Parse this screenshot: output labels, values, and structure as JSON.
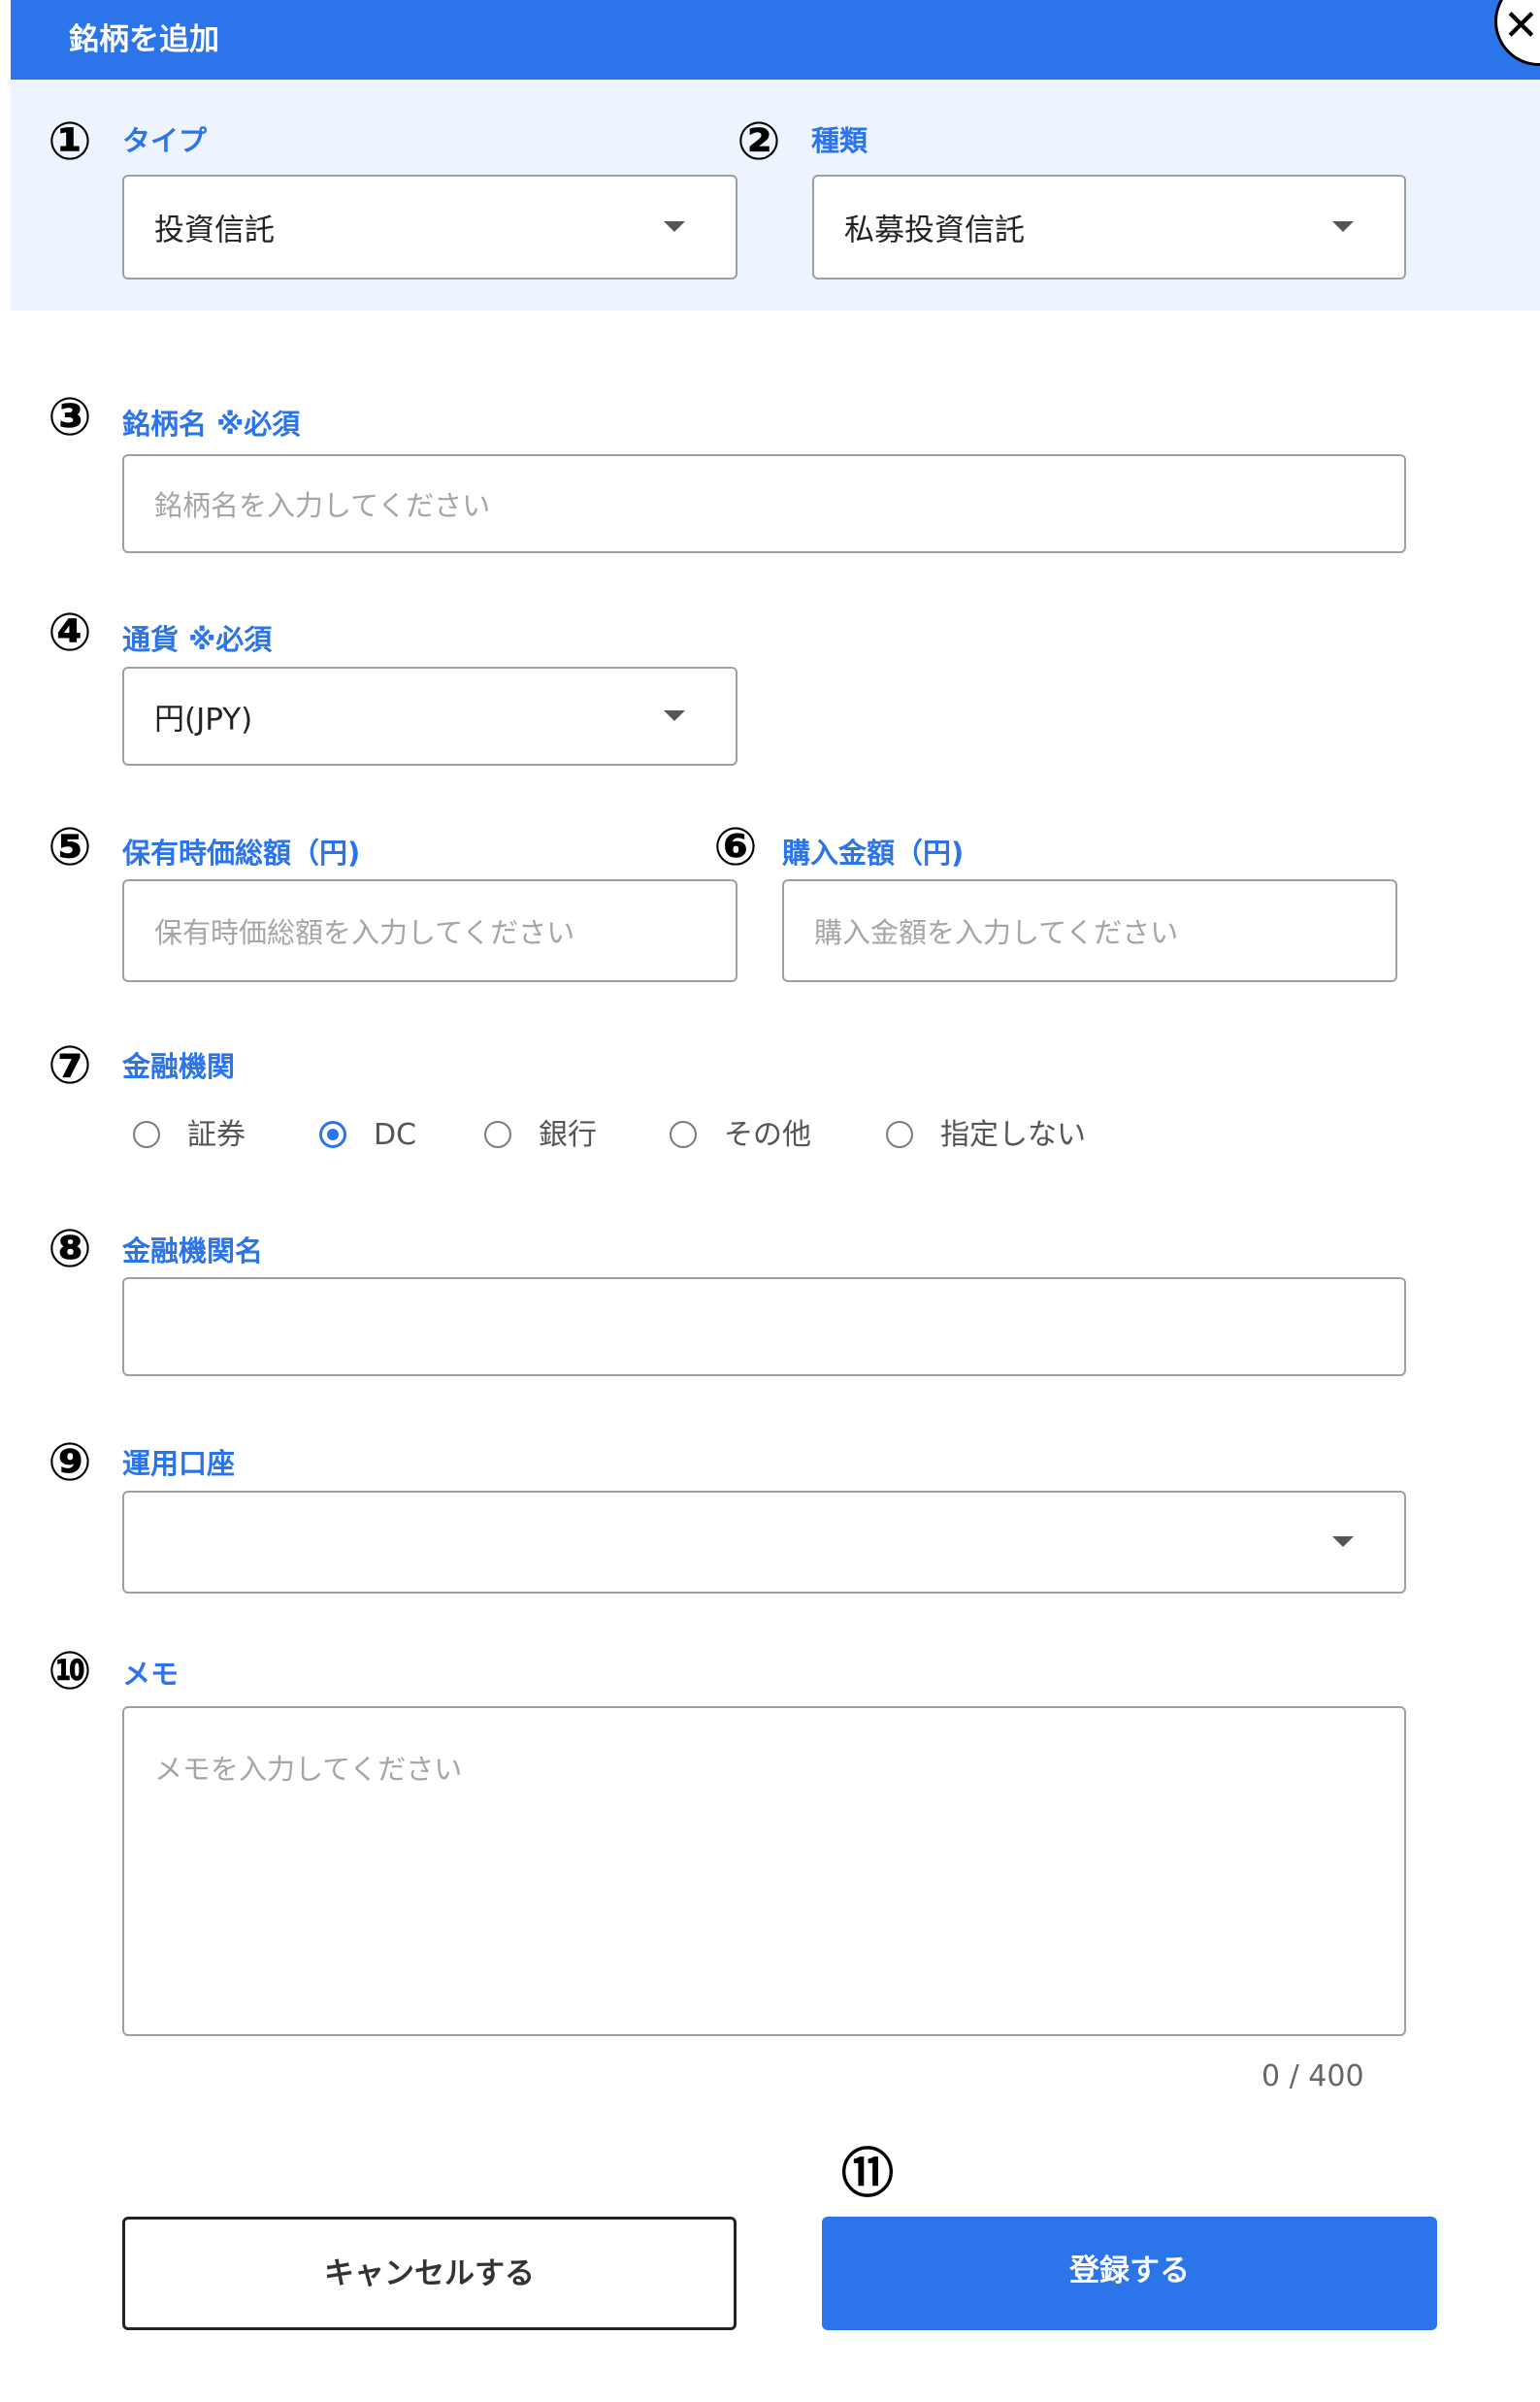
{
  "dialog": {
    "title": "銘柄を追加"
  },
  "fields": {
    "type": {
      "num": "①",
      "label": "タイプ",
      "value": "投資信託"
    },
    "kind": {
      "num": "②",
      "label": "種類",
      "value": "私募投資信託"
    },
    "name": {
      "num": "③",
      "label": "銘柄名 ※必須",
      "placeholder": "銘柄名を入力してください"
    },
    "currency": {
      "num": "④",
      "label": "通貨 ※必須",
      "value": "円(JPY)"
    },
    "holding_total": {
      "num": "⑤",
      "label": "保有時価総額（円)",
      "placeholder": "保有時価総額を入力してください"
    },
    "purchase_amount": {
      "num": "⑥",
      "label": "購入金額（円)",
      "placeholder": "購入金額を入力してください"
    },
    "institution": {
      "num": "⑦",
      "label": "金融機関",
      "options": [
        "証券",
        "DC",
        "銀行",
        "その他",
        "指定しない"
      ],
      "selected": "DC"
    },
    "institution_name": {
      "num": "⑧",
      "label": "金融機関名",
      "value": ""
    },
    "account": {
      "num": "⑨",
      "label": "運用口座",
      "value": ""
    },
    "memo": {
      "num": "⑩",
      "label": "メモ",
      "placeholder": "メモを入力してください",
      "counter": "0 / 400"
    }
  },
  "actions": {
    "num": "⑪",
    "cancel_label": "キャンセルする",
    "submit_label": "登録する"
  },
  "colors": {
    "accent": "#2b74e9",
    "panel": "#eef4fd",
    "border": "#9aa0a6",
    "placeholder": "#a5a5a5"
  }
}
